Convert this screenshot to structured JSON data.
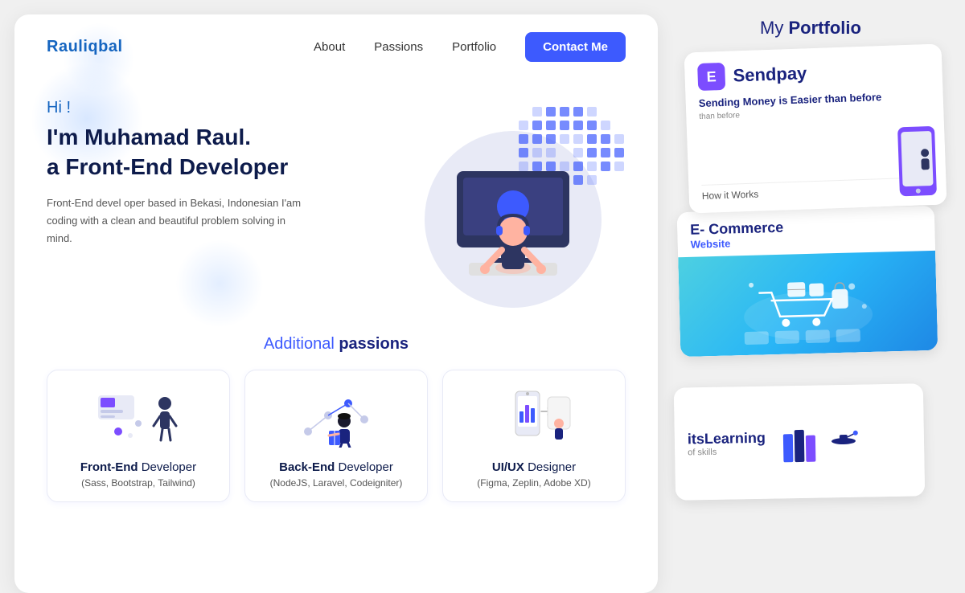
{
  "brand": {
    "name_start": "Raul",
    "name_end": "iqbal"
  },
  "nav": {
    "about": "About",
    "passions": "Passions",
    "portfolio": "Portfolio",
    "contact": "Contact Me"
  },
  "hero": {
    "greeting": "Hi !",
    "name_line": "I'm Muhamad Raul.",
    "role_line": "a Front-End Developer",
    "description": "Front-End devel oper based in Bekasi, Indonesian I'am coding with a clean and beautiful problem solving in mind."
  },
  "passions": {
    "title_normal": "Additional ",
    "title_bold": "passions",
    "cards": [
      {
        "title_bold": "Front-End",
        "title_rest": " Developer",
        "subtitle": "(Sass, Bootstrap, Tailwind)"
      },
      {
        "title_bold": "Back-End",
        "title_rest": " Developer",
        "subtitle": "(NodeJS, Laravel, Codeigniter)"
      },
      {
        "title_bold": "UI/UX",
        "title_rest": " Designer",
        "subtitle": "(Figma, Zeplin, Adobe XD)"
      }
    ]
  },
  "portfolio": {
    "title_normal": "My ",
    "title_bold": "Portfolio",
    "items": [
      {
        "name": "Sendpay",
        "tagline": "Sending Money is Easier than before",
        "howit": "How it Works"
      },
      {
        "name": "E- Commerce",
        "subtitle": "Website"
      },
      {
        "name": "itsLearning",
        "subtitle": "of skills"
      }
    ]
  },
  "colors": {
    "accent": "#3d5afe",
    "dark_blue": "#0d1b4b",
    "mid_blue": "#1565c0",
    "purple": "#7c4dff",
    "light_bg": "#e8eaf6"
  }
}
